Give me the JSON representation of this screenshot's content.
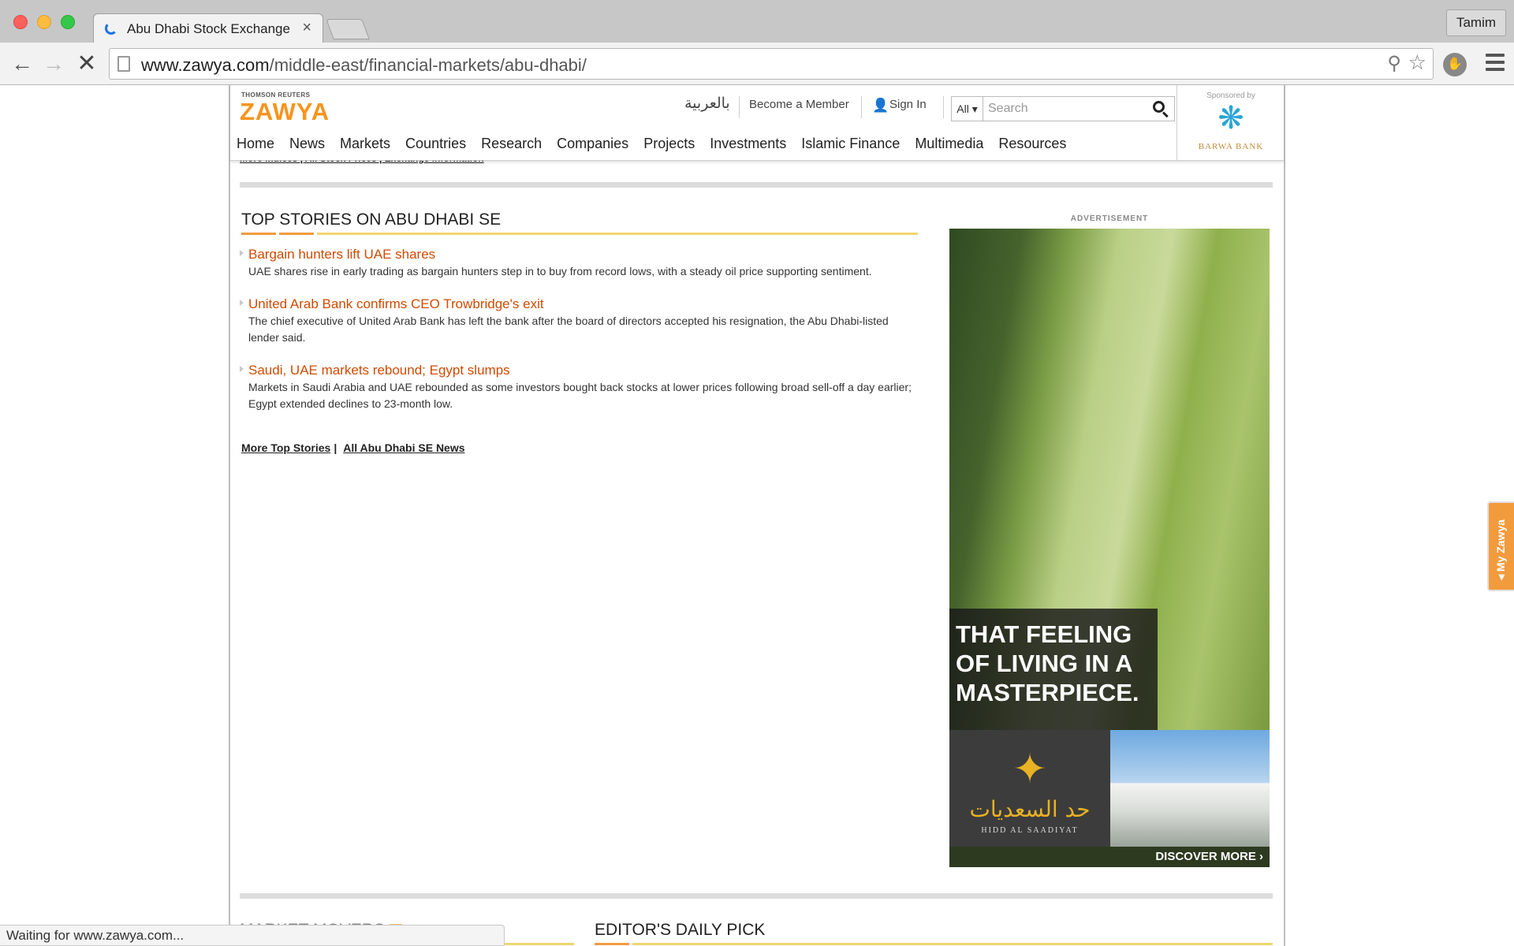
{
  "browser": {
    "tab_title": "Abu Dhabi Stock Exchange",
    "tab_close": "×",
    "profile_name": "Tamim",
    "url_host": "www.zawya.com",
    "url_path": "/middle-east/financial-markets/abu-dhabi/",
    "status_text": "Waiting for www.zawya.com..."
  },
  "header": {
    "brand_small": "THOMSON REUTERS",
    "brand": "ZAWYA",
    "arabic_link": "بالعربية",
    "member_link": "Become a Member",
    "signin_link": "Sign In",
    "search_scope": "All ▾",
    "search_placeholder": "Search",
    "sponsor_label": "Sponsored by",
    "sponsor_name": "BARWA BANK"
  },
  "nav": {
    "items": [
      "Home",
      "News",
      "Markets",
      "Countries",
      "Research",
      "Companies",
      "Projects",
      "Investments",
      "Islamic Finance",
      "Multimedia",
      "Resources"
    ]
  },
  "crumb_links": "More Indices | All Stock Prices | Exchange Information",
  "top_stories": {
    "title": "TOP STORIES ON ABU DHABI SE",
    "items": [
      {
        "headline": "Bargain hunters lift UAE shares",
        "summary": "UAE shares rise in early trading as bargain hunters step in to buy from record lows, with a steady oil price supporting sentiment."
      },
      {
        "headline": "United Arab Bank confirms CEO Trowbridge's exit",
        "summary": "The chief executive of United Arab Bank has left the bank after the board of directors accepted his resignation, the Abu Dhabi-listed lender said."
      },
      {
        "headline": "Saudi, UAE markets rebound; Egypt slumps",
        "summary": "Markets in Saudi Arabia and UAE rebounded as some investors bought back stocks at lower prices following broad sell-off a day earlier; Egypt extended declines to 23-month low."
      }
    ],
    "more_link": "More Top Stories",
    "separator": "|",
    "all_link": "All Abu Dhabi SE News"
  },
  "ad": {
    "label": "ADVERTISEMENT",
    "headline_1": "THAT FEELING",
    "headline_2": "OF LIVING IN A",
    "headline_3": "MASTERPIECE.",
    "brand_ar": "حد السعديات",
    "brand_en": "HIDD AL SAADIYAT",
    "cta": "DISCOVER MORE ›"
  },
  "sections": {
    "market_movers": "MARKET MOVERS",
    "market_movers_info": "i",
    "editors_pick": "EDITOR'S DAILY PICK"
  },
  "side_tab": {
    "label": "◂ My Zawya"
  },
  "colors": {
    "brand_orange": "#f7941d",
    "headline_orange": "#d04a02",
    "accent_yellow": "#f0d66e"
  }
}
